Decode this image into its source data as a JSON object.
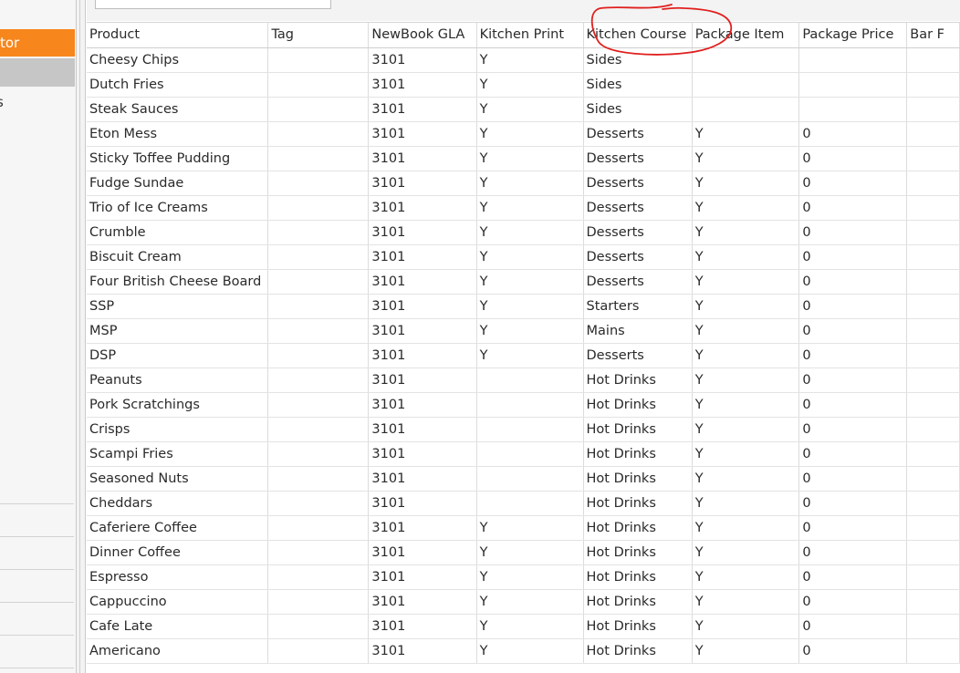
{
  "sidebar": {
    "active_item_label": "tor",
    "partial_item_label": "s"
  },
  "annotation": {
    "color": "#e0201e"
  },
  "table": {
    "columns": [
      "Product",
      "Tag",
      "NewBook GLA",
      "Kitchen Print",
      "Kitchen Course",
      "Package Item",
      "Package Price",
      "Bar F"
    ],
    "rows": [
      [
        "Cheesy Chips",
        "",
        "3101",
        "Y",
        "Sides",
        "",
        ""
      ],
      [
        "Dutch Fries",
        "",
        "3101",
        "Y",
        "Sides",
        "",
        ""
      ],
      [
        "Steak Sauces",
        "",
        "3101",
        "Y",
        "Sides",
        "",
        ""
      ],
      [
        "Eton Mess",
        "",
        "3101",
        "Y",
        "Desserts",
        "Y",
        "0"
      ],
      [
        "Sticky Toffee Pudding",
        "",
        "3101",
        "Y",
        "Desserts",
        "Y",
        "0"
      ],
      [
        "Fudge Sundae",
        "",
        "3101",
        "Y",
        "Desserts",
        "Y",
        "0"
      ],
      [
        "Trio of Ice Creams",
        "",
        "3101",
        "Y",
        "Desserts",
        "Y",
        "0"
      ],
      [
        "Crumble",
        "",
        "3101",
        "Y",
        "Desserts",
        "Y",
        "0"
      ],
      [
        "Biscuit Cream",
        "",
        "3101",
        "Y",
        "Desserts",
        "Y",
        "0"
      ],
      [
        "Four British Cheese Board",
        "",
        "3101",
        "Y",
        "Desserts",
        "Y",
        "0"
      ],
      [
        "SSP",
        "",
        "3101",
        "Y",
        "Starters",
        "Y",
        "0"
      ],
      [
        "MSP",
        "",
        "3101",
        "Y",
        "Mains",
        "Y",
        "0"
      ],
      [
        "DSP",
        "",
        "3101",
        "Y",
        "Desserts",
        "Y",
        "0"
      ],
      [
        "Peanuts",
        "",
        "3101",
        "",
        "Hot Drinks",
        "Y",
        "0"
      ],
      [
        "Pork Scratchings",
        "",
        "3101",
        "",
        "Hot Drinks",
        "Y",
        "0"
      ],
      [
        "Crisps",
        "",
        "3101",
        "",
        "Hot Drinks",
        "Y",
        "0"
      ],
      [
        "Scampi Fries",
        "",
        "3101",
        "",
        "Hot Drinks",
        "Y",
        "0"
      ],
      [
        "Seasoned Nuts",
        "",
        "3101",
        "",
        "Hot Drinks",
        "Y",
        "0"
      ],
      [
        "Cheddars",
        "",
        "3101",
        "",
        "Hot Drinks",
        "Y",
        "0"
      ],
      [
        "Caferiere Coffee",
        "",
        "3101",
        "Y",
        "Hot Drinks",
        "Y",
        "0"
      ],
      [
        "Dinner Coffee",
        "",
        "3101",
        "Y",
        "Hot Drinks",
        "Y",
        "0"
      ],
      [
        "Espresso",
        "",
        "3101",
        "Y",
        "Hot Drinks",
        "Y",
        "0"
      ],
      [
        "Cappuccino",
        "",
        "3101",
        "Y",
        "Hot Drinks",
        "Y",
        "0"
      ],
      [
        "Cafe Late",
        "",
        "3101",
        "Y",
        "Hot Drinks",
        "Y",
        "0"
      ],
      [
        "Americano",
        "",
        "3101",
        "Y",
        "Hot Drinks",
        "Y",
        "0"
      ]
    ]
  }
}
